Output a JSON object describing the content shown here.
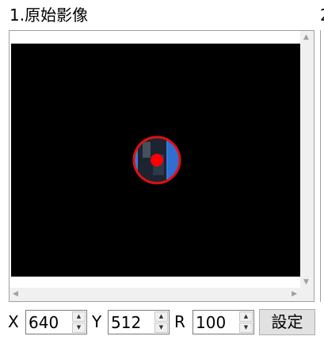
{
  "panel": {
    "title": "1.原始影像",
    "next_title_fragment": "2"
  },
  "controls": {
    "x_label": "X",
    "x_value": "640",
    "y_label": "Y",
    "y_value": "512",
    "r_label": "R",
    "r_value": "100",
    "set_button": "設定"
  },
  "colors": {
    "canvas_bg": "#000000",
    "marker_circle": "#e01010",
    "marker_dot": "#ff0000",
    "crop_blue": "#3a78d8"
  },
  "icons": {
    "spin_up": "up-arrow-icon",
    "spin_down": "down-arrow-icon",
    "scroll_up": "scroll-up-arrow-icon",
    "scroll_down": "scroll-down-arrow-icon",
    "scroll_left": "scroll-left-arrow-icon",
    "scroll_right": "scroll-right-arrow-icon"
  }
}
